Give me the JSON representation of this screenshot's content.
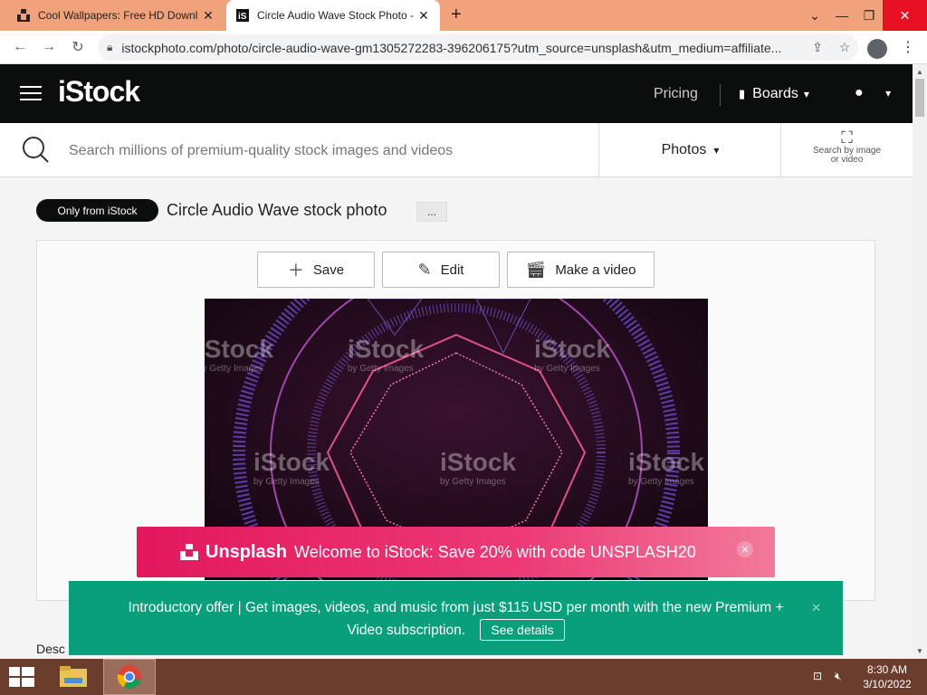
{
  "browser": {
    "tabs": [
      {
        "title": "Cool Wallpapers: Free HD Downl",
        "active": false
      },
      {
        "title": "Circle Audio Wave Stock Photo -",
        "active": true
      }
    ],
    "new_tab": "+",
    "window_controls": {
      "dropdown": "⌄",
      "minimize": "—",
      "maximize": "❐",
      "close": "✕"
    },
    "url": "istockphoto.com/photo/circle-audio-wave-gm1305272283-396206175?utm_source=unsplash&utm_medium=affiliate..."
  },
  "navbar": {
    "logo": "iStock",
    "pricing": "Pricing",
    "boards": "Boards"
  },
  "search": {
    "placeholder": "Search millions of premium-quality stock images and videos",
    "media_type": "Photos",
    "by_image_line1": "Search by image",
    "by_image_line2": "or video"
  },
  "asset": {
    "badge": "Only from iStock",
    "title": "Circle Audio Wave stock photo",
    "more": "...",
    "actions": {
      "save": "Save",
      "edit": "Edit",
      "make_video": "Make a video"
    },
    "watermark_main": "iStock",
    "watermark_sub": "by Getty Images"
  },
  "description_label": "Desc",
  "promo": {
    "brand": "Unsplash",
    "text": "Welcome to iStock: Save 20% with code UNSPLASH20",
    "close": "✕"
  },
  "offer": {
    "text_line1": "Introductory offer | Get images, videos, and music from just $115 USD per month with the new Premium +",
    "text_line2": "Video subscription.",
    "button": "See details",
    "close": "✕"
  },
  "taskbar": {
    "time": "8:30 AM",
    "date": "3/10/2022"
  },
  "colors": {
    "tabstrip": "#f0a27a",
    "navbar": "#0c0d0d",
    "promo": "#e3175d",
    "offer": "#07a07b",
    "taskbar": "#6b3d2c"
  }
}
